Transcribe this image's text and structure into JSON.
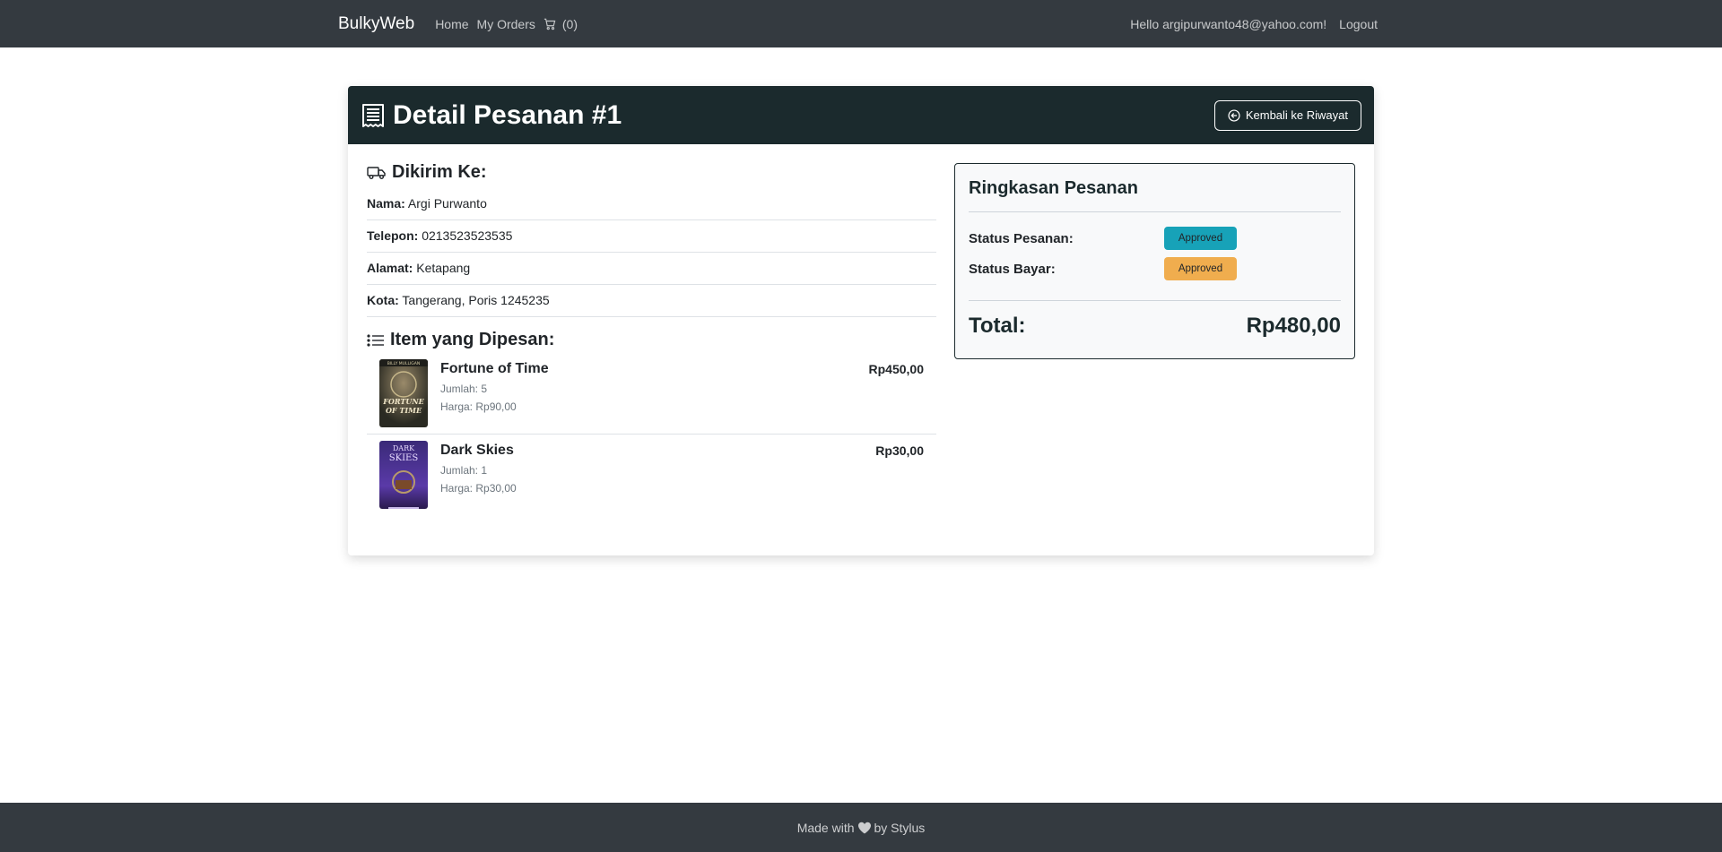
{
  "navbar": {
    "brand": "BulkyWeb",
    "links": [
      {
        "label": "Home"
      },
      {
        "label": "My Orders"
      }
    ],
    "cart_count": "(0)",
    "greeting": "Hello argipurwanto48@yahoo.com!",
    "logout": "Logout"
  },
  "header": {
    "title": "Detail Pesanan #1",
    "back_button": "Kembali ke Riwayat"
  },
  "shipping": {
    "title": "Dikirim Ke:",
    "rows": [
      {
        "label": "Nama:",
        "value": "Argi Purwanto"
      },
      {
        "label": "Telepon:",
        "value": "0213523523535"
      },
      {
        "label": "Alamat:",
        "value": "Ketapang"
      },
      {
        "label": "Kota:",
        "value": "Tangerang, Poris 1245235"
      }
    ]
  },
  "items": {
    "title": "Item yang Dipesan:",
    "list": [
      {
        "name": "Fortune of Time",
        "qty": "Jumlah: 5",
        "price": "Harga: Rp90,00",
        "total": "Rp450,00",
        "cover_text": "FORTUNE OF TIME",
        "cover_top": "BILLY MULLIGAN"
      },
      {
        "name": "Dark Skies",
        "qty": "Jumlah: 1",
        "price": "Harga: Rp30,00",
        "total": "Rp30,00",
        "cover_text": "DARK SKIES",
        "cover_top": ""
      }
    ]
  },
  "summary": {
    "title": "Ringkasan Pesanan",
    "order_status_label": "Status Pesanan:",
    "order_status": "Approved",
    "payment_status_label": "Status Bayar:",
    "payment_status": "Approved",
    "total_label": "Total:",
    "total_value": "Rp480,00"
  },
  "footer": {
    "prefix": "Made with",
    "suffix": "by Stylus"
  },
  "colors": {
    "navbar": "#343a40",
    "header": "#1b2a2d",
    "badge_info": "#17a2b8",
    "badge_warning": "#f0ad4e"
  }
}
